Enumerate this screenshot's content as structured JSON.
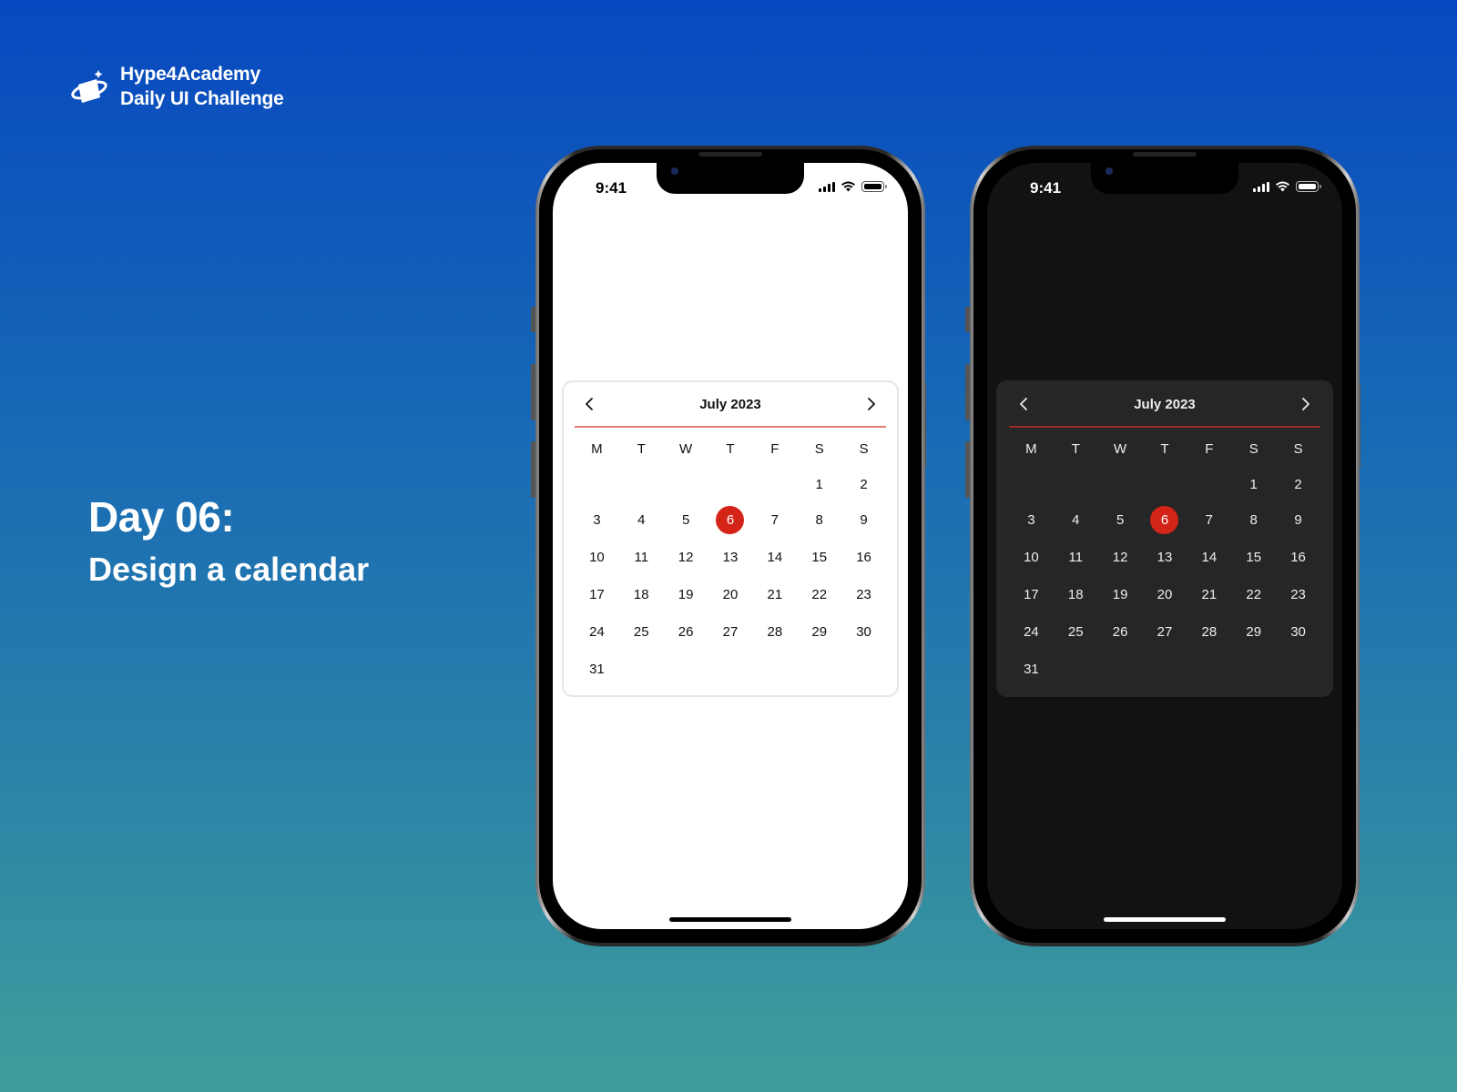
{
  "brand": {
    "name": "Hype4Academy",
    "tagline": "Daily UI Challenge",
    "logo_icon": "planet-cube-icon"
  },
  "headline": {
    "day": "Day 06:",
    "title": "Design a calendar"
  },
  "phones": [
    {
      "theme": "light",
      "status": {
        "time": "9:41",
        "icons": [
          "signal-icon",
          "wifi-icon",
          "battery-icon"
        ]
      },
      "calendar": {
        "title": "July 2023",
        "prev_icon": "chevron-left-icon",
        "next_icon": "chevron-right-icon",
        "weekdays": [
          "M",
          "T",
          "W",
          "T",
          "F",
          "S",
          "S"
        ],
        "selected_day": "6",
        "weeks": [
          [
            "",
            "",
            "",
            "",
            "",
            "1",
            "2"
          ],
          [
            "3",
            "4",
            "5",
            "6",
            "7",
            "8",
            "9"
          ],
          [
            "10",
            "11",
            "12",
            "13",
            "14",
            "15",
            "16"
          ],
          [
            "17",
            "18",
            "19",
            "20",
            "21",
            "22",
            "23"
          ],
          [
            "24",
            "25",
            "26",
            "27",
            "28",
            "29",
            "30"
          ],
          [
            "31",
            "",
            "",
            "",
            "",
            "",
            ""
          ]
        ]
      }
    },
    {
      "theme": "dark",
      "status": {
        "time": "9:41",
        "icons": [
          "signal-icon",
          "wifi-icon",
          "battery-icon"
        ]
      },
      "calendar": {
        "title": "July 2023",
        "prev_icon": "chevron-left-icon",
        "next_icon": "chevron-right-icon",
        "weekdays": [
          "M",
          "T",
          "W",
          "T",
          "F",
          "S",
          "S"
        ],
        "selected_day": "6",
        "weeks": [
          [
            "",
            "",
            "",
            "",
            "",
            "1",
            "2"
          ],
          [
            "3",
            "4",
            "5",
            "6",
            "7",
            "8",
            "9"
          ],
          [
            "10",
            "11",
            "12",
            "13",
            "14",
            "15",
            "16"
          ],
          [
            "17",
            "18",
            "19",
            "20",
            "21",
            "22",
            "23"
          ],
          [
            "24",
            "25",
            "26",
            "27",
            "28",
            "29",
            "30"
          ],
          [
            "31",
            "",
            "",
            "",
            "",
            "",
            ""
          ]
        ]
      }
    }
  ],
  "colors": {
    "accent": "#d42418",
    "bg_gradient_top": "#0848c0",
    "bg_gradient_bottom": "#3f9e9b",
    "dark_screen": "#121212",
    "dark_card": "#262626"
  }
}
